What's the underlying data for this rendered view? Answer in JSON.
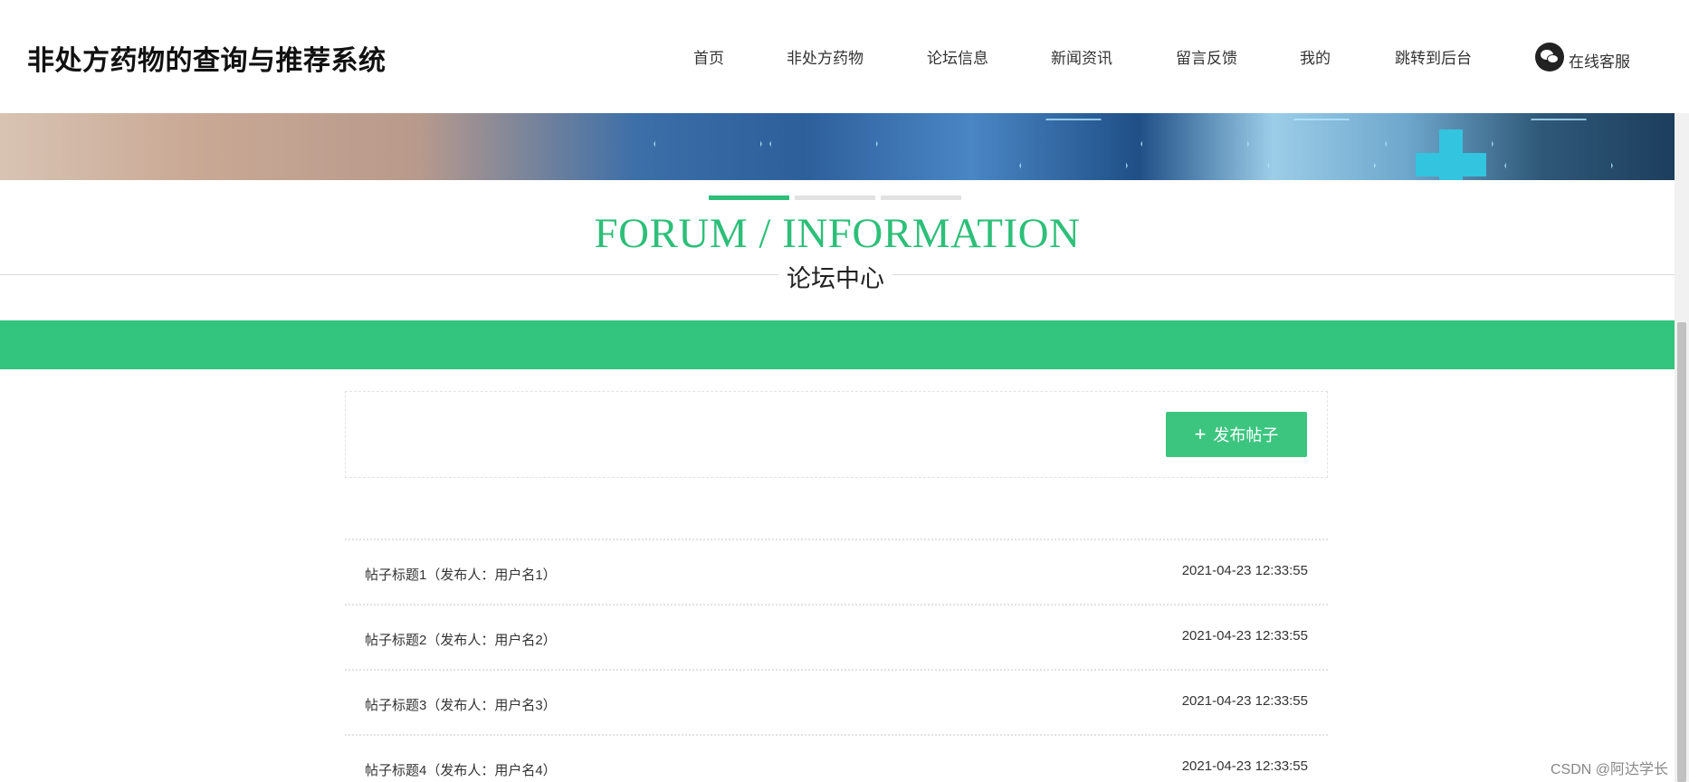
{
  "header": {
    "site_title": "非处方药物的查询与推荐系统",
    "nav": [
      "首页",
      "非处方药物",
      "论坛信息",
      "新闻资讯",
      "留言反馈",
      "我的",
      "跳转到后台"
    ],
    "service_label": "在线客服",
    "service_icon": "wechat-icon"
  },
  "section": {
    "title_en": "FORUM / INFORMATION",
    "title_cn": "论坛中心",
    "accent_color": "#2dbf79"
  },
  "actions": {
    "publish_label": "发布帖子",
    "publish_icon": "plus-icon"
  },
  "posts": [
    {
      "title": "帖子标题1（发布人：用户名1）",
      "time": "2021-04-23 12:33:55"
    },
    {
      "title": "帖子标题2（发布人：用户名2）",
      "time": "2021-04-23 12:33:55"
    },
    {
      "title": "帖子标题3（发布人：用户名3）",
      "time": "2021-04-23 12:33:55"
    },
    {
      "title": "帖子标题4（发布人：用户名4）",
      "time": "2021-04-23 12:33:55"
    }
  ],
  "watermark": "CSDN @阿达学长"
}
